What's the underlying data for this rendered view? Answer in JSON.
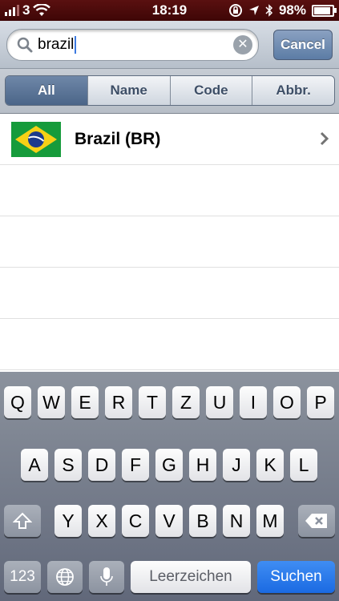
{
  "status_bar": {
    "carrier": "3",
    "time": "18:19",
    "battery": "98%",
    "battery_level": 0.98,
    "signal_bars": 3
  },
  "search": {
    "query": "brazil",
    "cancel_label": "Cancel"
  },
  "scope": {
    "segments": [
      "All",
      "Name",
      "Code",
      "Abbr."
    ],
    "selected": "All"
  },
  "results": [
    {
      "label": "Brazil (BR)",
      "flag": "brazil-flag-icon"
    }
  ],
  "keyboard": {
    "row1": [
      "Q",
      "W",
      "E",
      "R",
      "T",
      "Z",
      "U",
      "I",
      "O",
      "P"
    ],
    "row2": [
      "A",
      "S",
      "D",
      "F",
      "G",
      "H",
      "J",
      "K",
      "L"
    ],
    "row3": [
      "Y",
      "X",
      "C",
      "V",
      "B",
      "N",
      "M"
    ],
    "numbers_key": "123",
    "space_label": "Leerzeichen",
    "return_label": "Suchen"
  },
  "colors": {
    "status_bar": "#4a0b0b",
    "accent_blue": "#1b6ae2",
    "brazil_green": "#169b3b",
    "brazil_yellow": "#f7d116",
    "brazil_blue": "#1b3a8c"
  }
}
